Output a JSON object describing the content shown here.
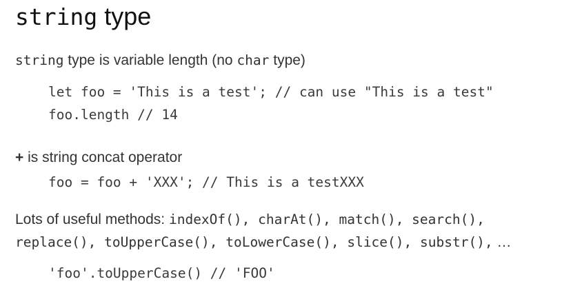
{
  "heading": {
    "code_part": "string",
    "text_part": " type"
  },
  "intro": {
    "code1": "string",
    "text1": " type is variable length (no ",
    "code2": "char",
    "text2": " type)"
  },
  "example1": {
    "line1": "let foo = 'This is a test';  // can use \"This is a test\"",
    "line2": "foo.length  // 14"
  },
  "concat": {
    "symbol": "+",
    "text": " is string concat  operator",
    "example": "foo = foo + 'XXX'; // This is a testXXX"
  },
  "methods": {
    "text": "Lots of useful methods: ",
    "list_line1": "indexOf(), charAt(), match(), search(),",
    "list_line2": "replace(), toUpperCase(), toLowerCase(), slice(), substr(),",
    "ellipsis": " …",
    "example": "'foo'.toUpperCase() // 'FOO'"
  }
}
